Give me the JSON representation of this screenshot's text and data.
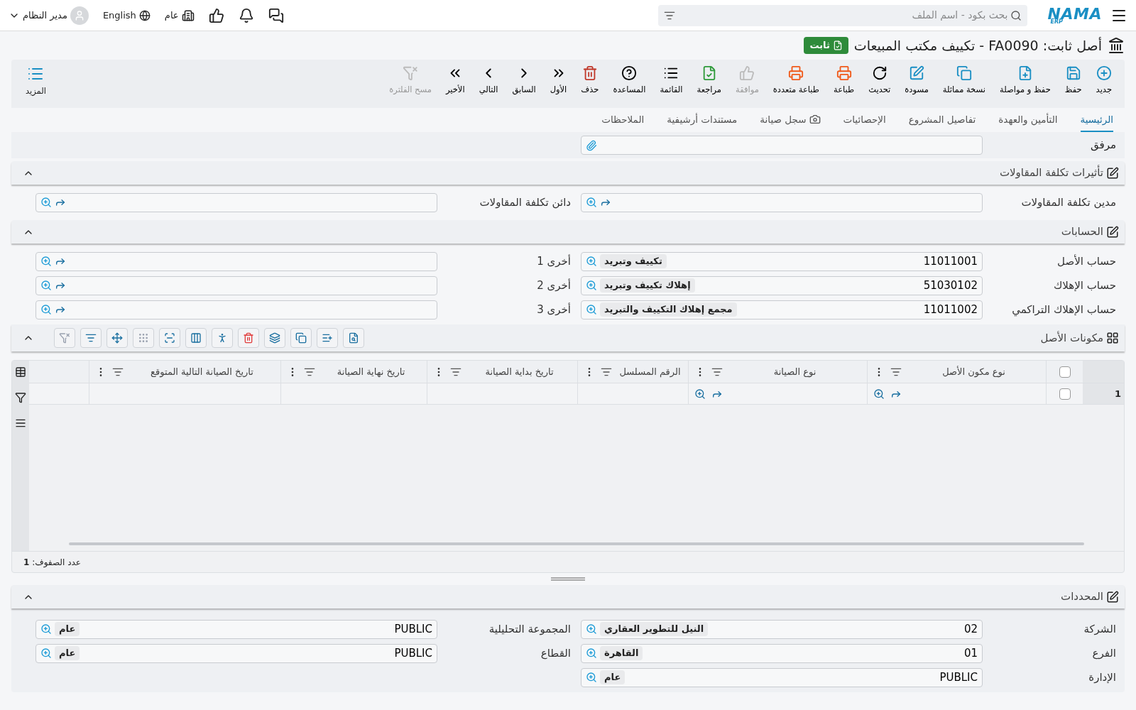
{
  "top_bar": {
    "logo": "NAMA",
    "logo_sub": "ERP",
    "search": {
      "placeholder": "بحث بكود - اسم الملف"
    },
    "user": "مدير النظام",
    "language": "English",
    "company": "عام"
  },
  "header": {
    "title": "أصل ثابت: FA0090 - تكييف مكتب المبيعات",
    "status": "ثابت"
  },
  "toolbar": [
    {
      "label": "جديد",
      "disabled": false
    },
    {
      "label": "حفظ",
      "disabled": false
    },
    {
      "label": "حفظ و مواصلة",
      "disabled": false
    },
    {
      "label": "نسخة مماثلة",
      "disabled": false
    },
    {
      "label": "مسودة",
      "disabled": false
    },
    {
      "label": "تحديث",
      "disabled": false
    },
    {
      "label": "طباعة",
      "disabled": false
    },
    {
      "label": "طباعة متعددة",
      "disabled": false
    },
    {
      "label": "موافقة",
      "disabled": true
    },
    {
      "label": "مراجعة",
      "disabled": false
    },
    {
      "label": "القائمة",
      "disabled": false
    },
    {
      "label": "المساعدة",
      "disabled": false
    },
    {
      "label": "حذف",
      "disabled": false
    },
    {
      "label": "الأول",
      "disabled": false
    },
    {
      "label": "السابق",
      "disabled": false
    },
    {
      "label": "التالي",
      "disabled": false
    },
    {
      "label": "الأخير",
      "disabled": false
    },
    {
      "label": "مسح الفلترة",
      "disabled": true
    }
  ],
  "more_button": "المزيد",
  "tabs": [
    {
      "label": "الرئيسية",
      "selected": true
    },
    {
      "label": "التأمين والعهدة",
      "selected": false
    },
    {
      "label": "تفاصيل المشروع",
      "selected": false
    },
    {
      "label": "الإحصائيات",
      "selected": false
    },
    {
      "label": "سجل صيانة",
      "selected": false
    },
    {
      "label": "مستندات أرشيفية",
      "selected": false
    },
    {
      "label": "الملاحظات",
      "selected": false
    }
  ],
  "attachment": {
    "label": "مرفق"
  },
  "sections": [
    {
      "title": "تأثيرات تكلفة المقاولات",
      "expanded": true,
      "fields": [
        {
          "label": "مدين تكلفة المقاولات"
        },
        {
          "label": "دائن تكلفة المقاولات"
        }
      ]
    },
    {
      "title": "الحسابات",
      "expanded": true,
      "fields": [
        {
          "label": "حساب الأصل",
          "value": "11011001",
          "name": "تكييف وتبريد"
        },
        {
          "label": "أخرى 1"
        },
        {
          "label": "حساب الإهلاك",
          "value": "51030102",
          "name": "إهلاك تكييف وتبريد"
        },
        {
          "label": "أخرى 2"
        },
        {
          "label": "حساب الإهلاك التراكمي",
          "value": "11011002",
          "name": "مجمع إهلاك التكييف والتبريد"
        },
        {
          "label": "أخرى 3"
        }
      ]
    }
  ],
  "components": {
    "title": "مكونات الأصل",
    "expanded": true,
    "columns": [
      "نوع مكون الأصل",
      "نوع الصيانة",
      "الرقم المسلسل",
      "تاريخ بداية الصيانة",
      "تاريخ نهاية الصيانة",
      "تاريخ الصيانة التالية المتوقع"
    ],
    "all_checked": false,
    "rows": [
      {
        "number": "1",
        "checked": false
      }
    ],
    "row_count": "عدد الصفوف: **1**"
  },
  "limits": {
    "title": "المحددات",
    "expanded": true,
    "fields": [
      {
        "label": "الشركة",
        "value": "02",
        "name": "النيل للتطوير العقاري"
      },
      {
        "label": "المجموعة التحليلية",
        "value": "PUBLIC",
        "name": "عام"
      },
      {
        "label": "الفرع",
        "value": "01",
        "name": "القاهرة"
      },
      {
        "label": "القطاع",
        "value": "PUBLIC",
        "name": "عام"
      },
      {
        "label": "الإدارة",
        "value": "PUBLIC",
        "name": "عام"
      }
    ]
  }
}
